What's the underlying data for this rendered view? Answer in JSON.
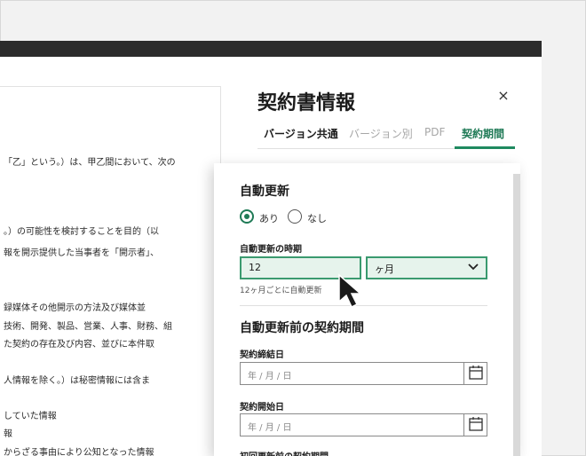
{
  "panel": {
    "title": "契約書情報",
    "close": "×",
    "tabs": [
      "バージョン共通",
      "バージョン別",
      "PDF",
      "契約期間"
    ]
  },
  "auto_renew": {
    "title": "自動更新",
    "options": [
      "あり",
      "なし"
    ],
    "selected": "あり",
    "timing_label": "自動更新の時期",
    "timing_value": "12",
    "unit_value": "ヶ月",
    "hint": "12ヶ月ごとに自動更新"
  },
  "period": {
    "title": "自動更新前の契約期間",
    "signing_label": "契約締結日",
    "signing_placeholder": "年 / 月 / 日",
    "start_label": "契約開始日",
    "start_placeholder": "年 / 月 / 日",
    "next_label": "初回更新前の契約期間"
  },
  "document": {
    "lines": [
      "「乙」という。）は、甲乙間において、次の",
      "。）の可能性を検討することを目的（以",
      "報を開示提供した当事者を「開示者」、",
      "録媒体その他開示の方法及び媒体並",
      "技術、開発、製品、営業、人事、財務、組",
      "た契約の存在及び内容、並びに本件取",
      "人情報を除く。）は秘密情報には含ま",
      "していた情報",
      "報",
      "からざる事由により公知となった情報"
    ]
  }
}
